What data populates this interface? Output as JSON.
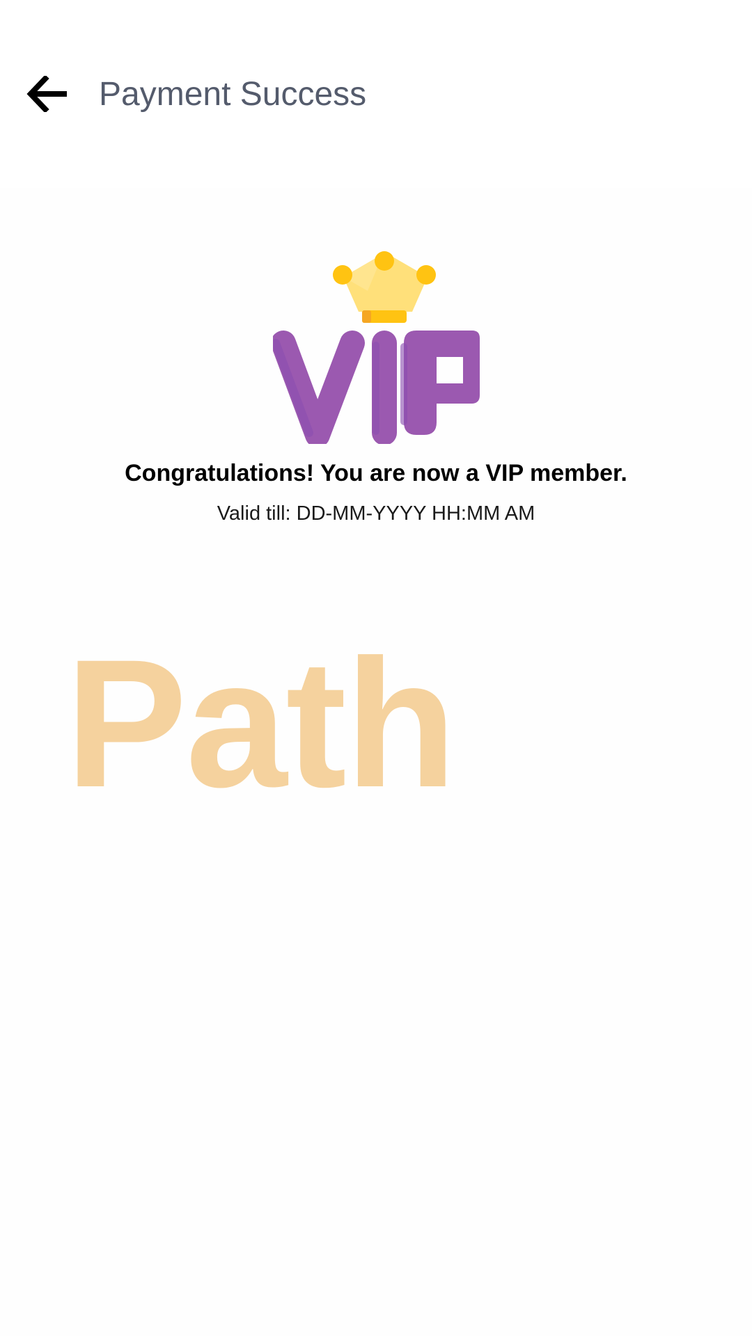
{
  "header": {
    "back_icon": "arrow-left-icon",
    "title": "Payment Success"
  },
  "badge": {
    "icon": "vip-crown-icon",
    "text": "VIP",
    "colors": {
      "letters": "#9b59b0",
      "letters_shadow": "#7d4aa6",
      "crown": "#ffe07a",
      "crown_gems": "#ffc312",
      "crown_band": "#ffc312",
      "crown_band_accent": "#f5a623"
    }
  },
  "message": {
    "congrats": "Congratulations! You are now a VIP member.",
    "valid_till": "Valid till: DD-MM-YYYY HH:MM AM"
  },
  "watermark": {
    "text": "Path",
    "color": "#f5d29e"
  }
}
